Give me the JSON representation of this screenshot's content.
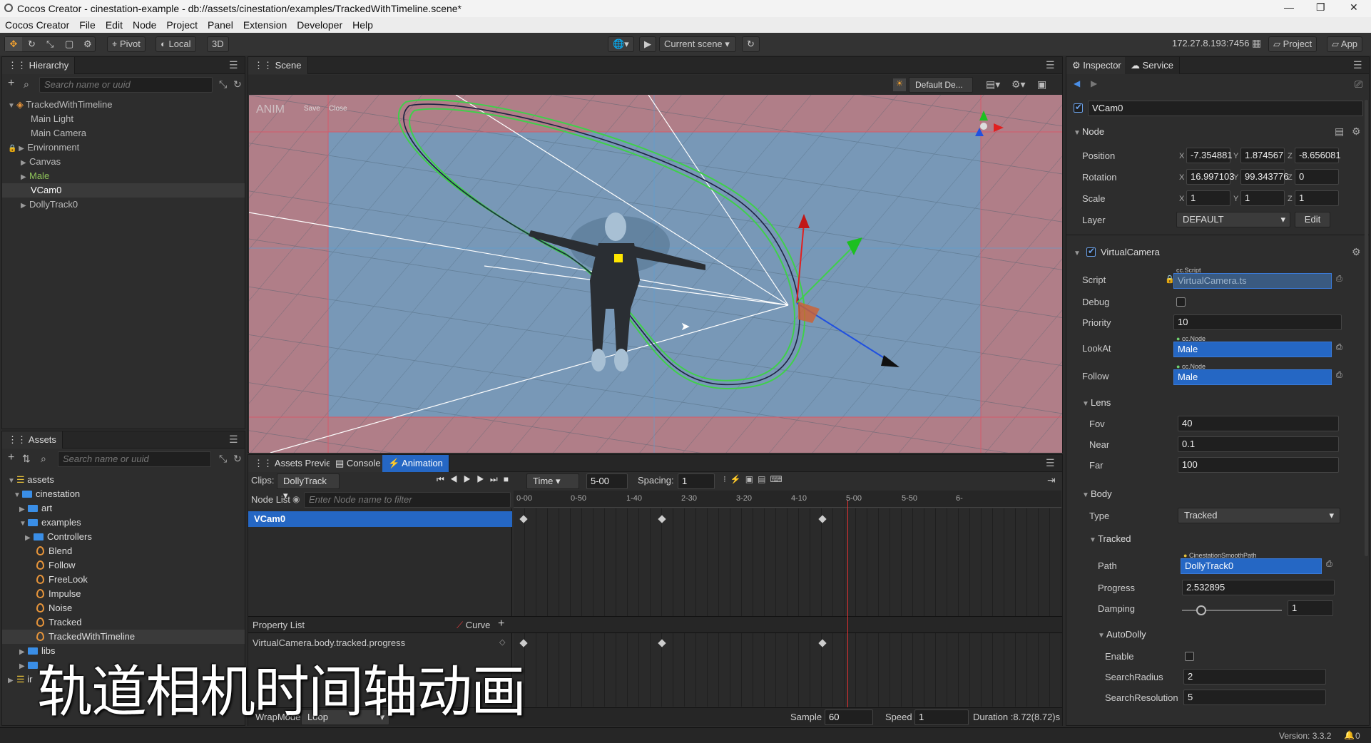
{
  "window": {
    "title": "Cocos Creator - cinestation-example - db://assets/cinestation/examples/TrackedWithTimeline.scene*"
  },
  "menu": [
    "Cocos Creator",
    "File",
    "Edit",
    "Node",
    "Project",
    "Panel",
    "Extension",
    "Developer",
    "Help"
  ],
  "toolbar": {
    "pivot": "Pivot",
    "local": "Local",
    "mode3d": "3D",
    "scene_select": "Current scene",
    "ip": "172.27.8.193:7456",
    "project": "Project",
    "app": "App"
  },
  "hierarchy": {
    "tab": "Hierarchy",
    "search_placeholder": "Search name or uuid",
    "items": [
      {
        "label": "TrackedWithTimeline"
      },
      {
        "label": "Main Light"
      },
      {
        "label": "Main Camera"
      },
      {
        "label": "Environment"
      },
      {
        "label": "Canvas"
      },
      {
        "label": "Male"
      },
      {
        "label": "VCam0"
      },
      {
        "label": "DollyTrack0"
      }
    ]
  },
  "assets": {
    "tab": "Assets",
    "search_placeholder": "Search name or uuid",
    "items": [
      {
        "label": "assets"
      },
      {
        "label": "cinestation"
      },
      {
        "label": "art"
      },
      {
        "label": "examples"
      },
      {
        "label": "Controllers"
      },
      {
        "label": "Blend"
      },
      {
        "label": "Follow"
      },
      {
        "label": "FreeLook"
      },
      {
        "label": "Impulse"
      },
      {
        "label": "Noise"
      },
      {
        "label": "Tracked"
      },
      {
        "label": "TrackedWithTimeline"
      },
      {
        "label": "libs"
      },
      {
        "label": "ir"
      }
    ]
  },
  "scene": {
    "tab": "Scene",
    "camera_select": "Default De...",
    "anim_label": "ANIM",
    "save": "Save",
    "close": "Close"
  },
  "bottom_tabs": {
    "preview": "Assets Preview",
    "console": "Console",
    "animation": "Animation"
  },
  "animation": {
    "clips_label": "Clips:",
    "clip": "DollyTrack",
    "time_mode": "Time",
    "time_value": "5-00",
    "spacing_label": "Spacing:",
    "spacing": "1",
    "node_list_label": "Node List",
    "node_filter_placeholder": "Enter Node name to filter",
    "node": "VCam0",
    "ruler": [
      "0-00",
      "0-50",
      "1-40",
      "2-30",
      "3-20",
      "4-10",
      "5-00",
      "5-50",
      "6-"
    ],
    "property_list_label": "Property List",
    "curve": "Curve",
    "property": "VirtualCamera.body.tracked.progress",
    "wrap_label": "WrapMode",
    "wrap": "Loop",
    "sample_label": "Sample",
    "sample": "60",
    "speed_label": "Speed",
    "speed": "1",
    "duration": "Duration :8.72(8.72)s"
  },
  "inspector": {
    "tab": "Inspector",
    "service_tab": "Service",
    "node_name": "VCam0",
    "node_section": "Node",
    "position_label": "Position",
    "pos": [
      "-7.354881",
      "1.874567",
      "-8.656081"
    ],
    "rotation_label": "Rotation",
    "rot": [
      "16.997103",
      "99.343776",
      "0"
    ],
    "scale_label": "Scale",
    "scale": [
      "1",
      "1",
      "1"
    ],
    "layer_label": "Layer",
    "layer": "DEFAULT",
    "edit": "Edit",
    "component": "VirtualCamera",
    "script_label": "Script",
    "script_tag": "cc.Script",
    "script": "VirtualCamera.ts",
    "debug_label": "Debug",
    "priority_label": "Priority",
    "priority": "10",
    "lookat_label": "LookAt",
    "lookat_tag": "cc.Node",
    "lookat": "Male",
    "follow_label": "Follow",
    "follow_tag": "cc.Node",
    "follow": "Male",
    "lens": "Lens",
    "fov_label": "Fov",
    "fov": "40",
    "near_label": "Near",
    "near": "0.1",
    "far_label": "Far",
    "far": "100",
    "body": "Body",
    "type_label": "Type",
    "type": "Tracked",
    "tracked": "Tracked",
    "path_label": "Path",
    "path_tag": "CinestationSmoothPath",
    "path": "DollyTrack0",
    "progress_label": "Progress",
    "progress": "2.532895",
    "damping_label": "Damping",
    "damping": "1",
    "autodolly": "AutoDolly",
    "enable_label": "Enable",
    "search_radius_label": "SearchRadius",
    "search_radius": "2",
    "search_resolution_label": "SearchResolution",
    "search_resolution": "5"
  },
  "status": {
    "version": "Version: 3.3.2",
    "errors": "0"
  },
  "subtitle": "轨道相机时间轴动画",
  "axes": {
    "x": "X",
    "y": "Y",
    "z": "Z"
  }
}
